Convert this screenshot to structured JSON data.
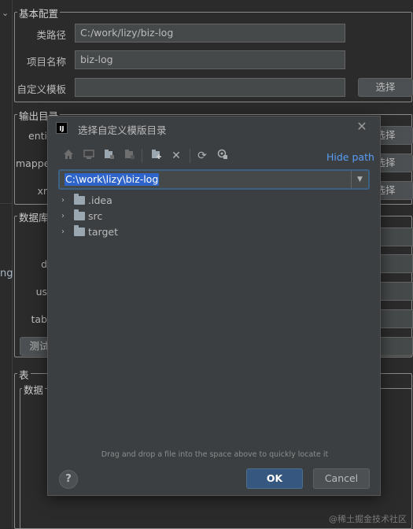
{
  "settings": {
    "group_basic": "基本配置",
    "class_path_label": "类路径",
    "class_path_value": "C:/work/lizy/biz-log",
    "project_name_label": "项目名称",
    "project_name_value": "biz-log",
    "template_label": "自定义模板",
    "template_value": "",
    "choose_button": "选择",
    "group_output": "输出目录",
    "output_rows": [
      {
        "label": "enti",
        "button": "选择"
      },
      {
        "label": "mappe",
        "button": "选择"
      },
      {
        "label": "xr",
        "button": "选择"
      }
    ],
    "group_db": "数据库",
    "db_rows": [
      {
        "label": "d"
      },
      {
        "label": "us"
      },
      {
        "label": "tab"
      }
    ],
    "test_button": "测试",
    "group_table": "表",
    "group_data": "数据",
    "left_text": "ng"
  },
  "dialog": {
    "logo": "IJ",
    "title": "选择自定义模版目录",
    "toolbar_icons": [
      "home-icon",
      "desktop-icon",
      "project-icon",
      "module-icon",
      "new-folder-icon",
      "delete-icon",
      "refresh-icon",
      "show-hidden-icon"
    ],
    "hide_path": "Hide path",
    "path": "C:\\work\\lizy\\biz-log",
    "tree": [
      {
        "name": ".idea"
      },
      {
        "name": "src"
      },
      {
        "name": "target"
      }
    ],
    "drag_hint": "Drag and drop a file into the space above to quickly locate it",
    "help": "?",
    "ok": "OK",
    "cancel": "Cancel"
  },
  "watermark": "@稀土掘金技术社区"
}
